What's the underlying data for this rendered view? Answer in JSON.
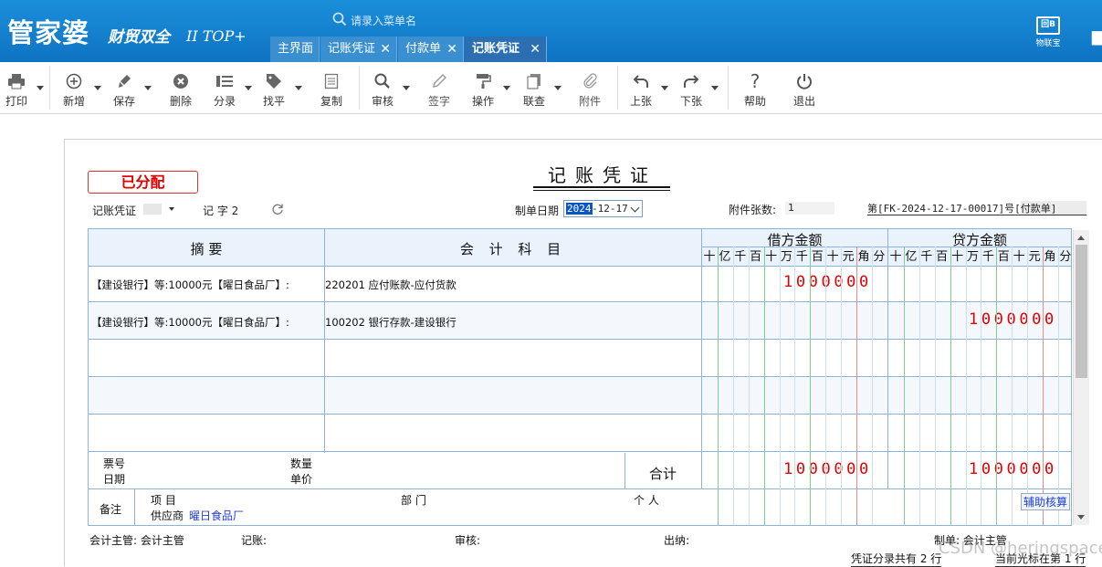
{
  "app": {
    "logo_main": "管家婆",
    "logo_sub": "财贸双全",
    "logo_edition": "II TOP+",
    "search_placeholder": "请录入菜单名",
    "iot_label": "物联宝",
    "iot_badge": "回B"
  },
  "tabs": [
    {
      "label": "主界面",
      "closable": false,
      "active": false
    },
    {
      "label": "记账凭证",
      "closable": true,
      "active": false
    },
    {
      "label": "付款单",
      "closable": true,
      "active": false
    },
    {
      "label": "记账凭证",
      "closable": true,
      "active": true
    }
  ],
  "toolbar": {
    "print": "打印",
    "new": "新增",
    "save": "保存",
    "delete": "删除",
    "split": "分录",
    "balance": "找平",
    "copy": "复制",
    "audit": "审核",
    "sign": "签字",
    "operate": "操作",
    "lookup": "联查",
    "attach": "附件",
    "prev": "上张",
    "next": "下张",
    "help": "帮助",
    "exit": "退出"
  },
  "voucher": {
    "status_stamp": "已分配",
    "title": "记账凭证",
    "type_value": "记账凭证",
    "word_label": "记 字",
    "word_number": "2",
    "date_label": "制单日期",
    "date_year": "2024",
    "date_rest": "-12-17",
    "attachments_label": "附件张数:",
    "attachments_value": "1",
    "voucher_no": "第[FK-2024-12-17-00017]号[付款单]"
  },
  "table": {
    "col_summary": "摘  要",
    "col_account": "会 计 科 目",
    "col_debit": "借方金额",
    "col_credit": "贷方金额",
    "digit_units": [
      "十",
      "亿",
      "千",
      "百",
      "十",
      "万",
      "千",
      "百",
      "十",
      "元",
      "角",
      "分"
    ],
    "rows": [
      {
        "summary": "【建设银行】等:10000元【曜日食品厂】:",
        "account": "220201 应付账款-应付货款",
        "debit": "1000000",
        "credit": ""
      },
      {
        "summary": "【建设银行】等:10000元【曜日食品厂】:",
        "account": "100202 银行存款-建设银行",
        "debit": "",
        "credit": "1000000"
      },
      {
        "summary": "",
        "account": "",
        "debit": "",
        "credit": ""
      },
      {
        "summary": "",
        "account": "",
        "debit": "",
        "credit": ""
      },
      {
        "summary": "",
        "account": "",
        "debit": "",
        "credit": ""
      }
    ],
    "footer": {
      "ticket_no": "票号",
      "date": "日期",
      "quantity": "数量",
      "unit_price": "单价",
      "total_label": "合计",
      "total_debit": "1000000",
      "total_credit": "1000000"
    },
    "memo": {
      "label": "备注",
      "project": "项 目",
      "department": "部 门",
      "person": "个 人",
      "supplier_label": "供应商",
      "supplier_value": "曜日食品厂",
      "assist_button": "辅助核算"
    }
  },
  "signatures": {
    "chief": "会计主管: 会计主管",
    "bookkeeping": "记账:",
    "audit": "审核:",
    "cashier": "出纳:",
    "maker": "制单: 会计主管"
  },
  "status": {
    "entries": "凭证分录共有 2 行",
    "cursor": "当前光标在第 1 行"
  },
  "watermark": "CSDN @heringspace"
}
